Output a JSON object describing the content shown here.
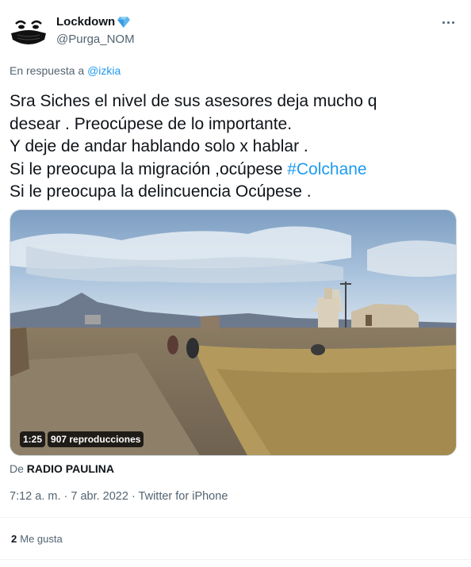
{
  "author": {
    "display_name": "Lockdown",
    "handle": "@Purga_NOM",
    "verified_icon": "diamond-icon",
    "avatar": "masked-face-avatar"
  },
  "more_icon": "ellipsis-icon",
  "reply": {
    "prefix": "En respuesta a",
    "mention": "@izkia"
  },
  "tweet": {
    "lines": [
      "Sra Siches el nivel de sus asesores deja mucho q",
      "desear . Preocúpese de lo importante.",
      "Y deje de andar hablando solo x hablar .",
      "Si le preocupa la migración ,ocúpese ",
      "Si le preocupa la delincuencia Ocúpese ."
    ],
    "hashtag": "#Colchane"
  },
  "media": {
    "duration": "1:25",
    "views": "907 reproducciones"
  },
  "source": {
    "prefix": "De",
    "name": "RADIO PAULINA"
  },
  "meta": "7:12 a. m. · 7 abr. 2022 · Twitter for iPhone",
  "likes": {
    "count": "2",
    "label": "Me gusta"
  },
  "colors": {
    "link": "#1d9bf0",
    "text": "#0f1419",
    "secondary": "#536471",
    "divider": "#eff3f4"
  }
}
